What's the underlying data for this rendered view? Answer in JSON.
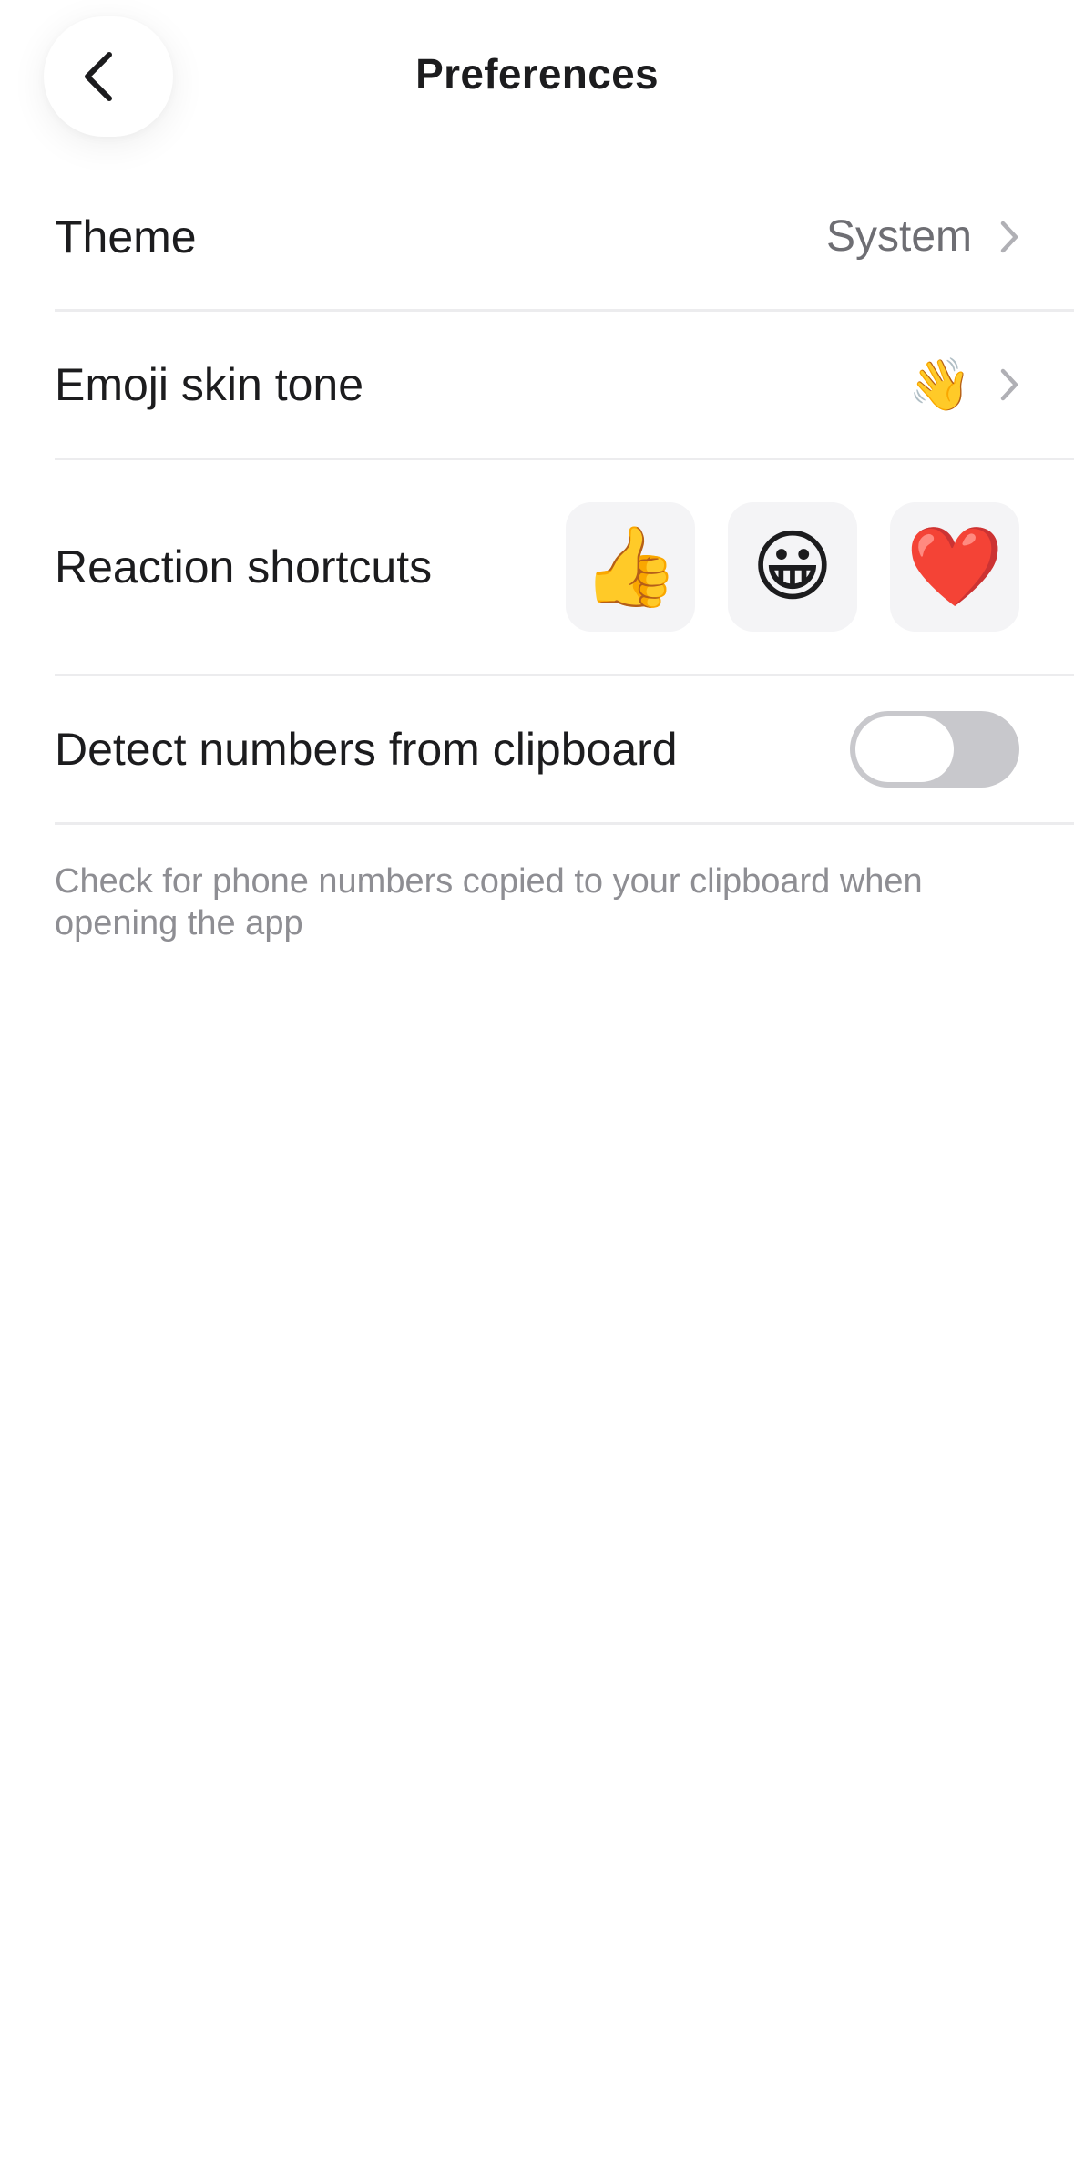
{
  "header": {
    "title": "Preferences",
    "back_icon": "chevron-left-icon"
  },
  "settings": {
    "theme": {
      "label": "Theme",
      "value": "System"
    },
    "emoji_skin_tone": {
      "label": "Emoji skin tone",
      "value_emoji": "👋"
    },
    "reaction_shortcuts": {
      "label": "Reaction shortcuts",
      "emojis": [
        "👍",
        "😀",
        "❤️"
      ]
    },
    "detect_clipboard": {
      "label": "Detect numbers from clipboard",
      "enabled": false,
      "description": "Check for phone numbers copied to your clipboard when opening the app"
    }
  },
  "colors": {
    "background": "#ffffff",
    "text_primary": "#1c1c1e",
    "text_secondary": "#6e6e73",
    "text_muted": "#8e8e93",
    "divider": "#ececee",
    "toggle_off": "#c8c8cc",
    "tile_bg": "#f4f4f6"
  }
}
